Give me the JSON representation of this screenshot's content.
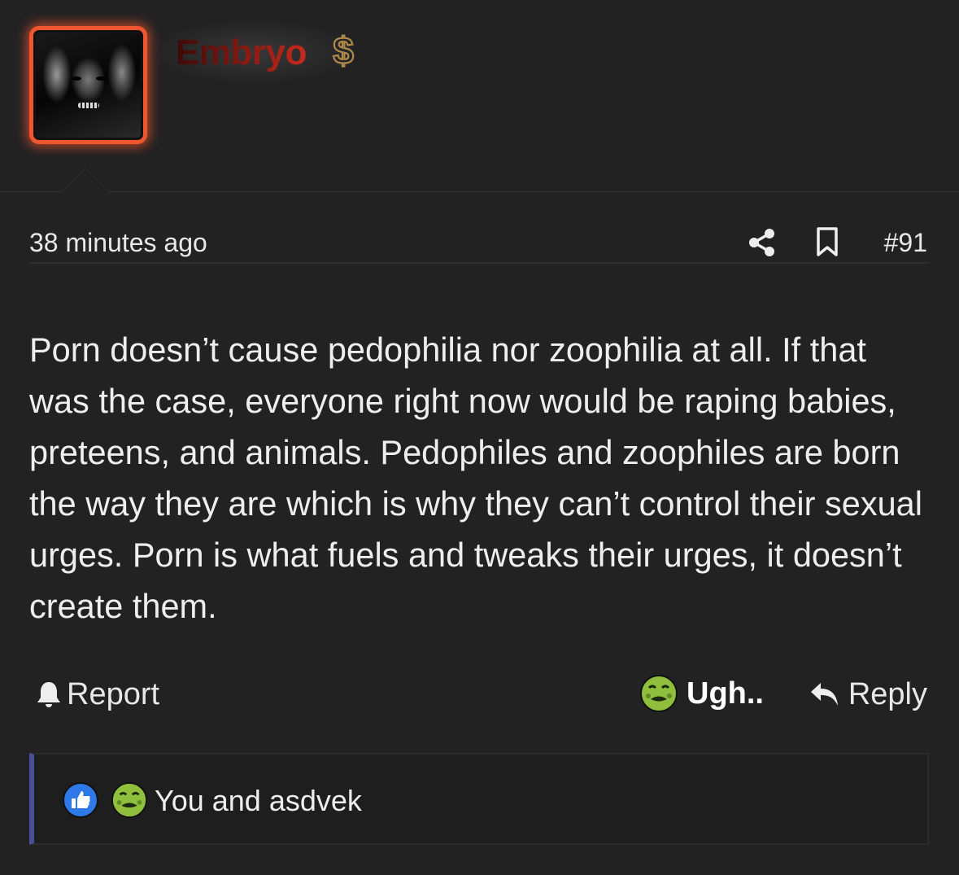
{
  "user": {
    "name": "Embryo",
    "badge_icon": "dollar-sign-icon",
    "badge_color": "#b08a4a",
    "avatar_border_color": "#f0562d",
    "name_color": "#a8201a"
  },
  "meta": {
    "time": "38 minutes ago",
    "share_icon": "share-icon",
    "bookmark_icon": "bookmark-icon",
    "post_number": "#91"
  },
  "post": {
    "body": "Porn doesn’t cause pedophilia nor zoophilia at all. If that was the case, everyone right now would be raping babies, preteens, and animals. Pedophiles and zoophiles are born the way they are which is why they can’t control their sexual urges. Porn is what fuels and tweaks their urges, it doesn’t create them."
  },
  "actions": {
    "report": "Report",
    "reaction": "Ugh..",
    "reaction_icon": "nauseated-face-icon",
    "reply": "Reply"
  },
  "reactions_summary": {
    "icons": [
      "thumbs-up-icon",
      "nauseated-face-icon"
    ],
    "text": "You and asdvek",
    "accent_color": "#4b4f9a"
  }
}
